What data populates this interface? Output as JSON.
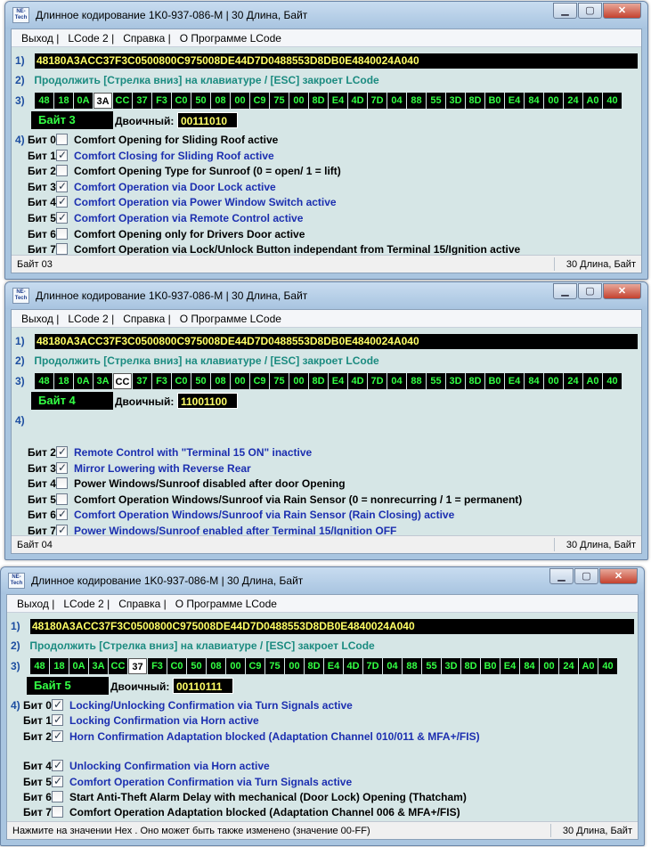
{
  "windows": [
    {
      "title": "Длинное кодирование  1K0-937-086-M | 30 Длина, Байт",
      "logo_text": "NE-Tech",
      "menu": [
        "Выход |",
        "LCode 2 |",
        "Справка |",
        "О Программе LCode"
      ],
      "step1_num": "1)",
      "hex_string": "48180A3ACC37F3C0500800C975008DE44D7D0488553D8DB0E4840024A040",
      "step2_num": "2)",
      "step2_text": "Продолжить [Стрелка вниз] на клавиатуре / [ESC] закроет LCode",
      "step3_num": "3)",
      "bytes": [
        "48",
        "18",
        "0A",
        "3A",
        "CC",
        "37",
        "F3",
        "C0",
        "50",
        "08",
        "00",
        "C9",
        "75",
        "00",
        "8D",
        "E4",
        "4D",
        "7D",
        "04",
        "88",
        "55",
        "3D",
        "8D",
        "B0",
        "E4",
        "84",
        "00",
        "24",
        "A0",
        "40"
      ],
      "selected_byte_index": 3,
      "byte_label": "Байт 3",
      "binary_label": "Двоичный:",
      "binary_value": "00111010",
      "step4_num": "4)",
      "bits": [
        {
          "label": "Бит 0",
          "checked": false,
          "text": "Comfort Opening for Sliding Roof active"
        },
        {
          "label": "Бит 1",
          "checked": true,
          "text": "Comfort Closing for Sliding Roof active"
        },
        {
          "label": "Бит 2",
          "checked": false,
          "text": "Comfort Opening Type for Sunroof (0 = open/ 1 = lift)"
        },
        {
          "label": "Бит 3",
          "checked": true,
          "text": "Comfort Operation via Door Lock active"
        },
        {
          "label": "Бит 4",
          "checked": true,
          "text": "Comfort Operation via Power Window Switch active"
        },
        {
          "label": "Бит 5",
          "checked": true,
          "text": "Comfort Operation via Remote Control active"
        },
        {
          "label": "Бит 6",
          "checked": false,
          "text": "Comfort Opening only for Drivers Door active"
        },
        {
          "label": "Бит 7",
          "checked": false,
          "text": "Comfort Operation via Lock/Unlock Button independant from Terminal 15/Ignition active"
        }
      ],
      "status_left": "Байт 03",
      "status_right": "30 Длина, Байт"
    },
    {
      "title": "Длинное кодирование  1K0-937-086-M | 30 Длина, Байт",
      "logo_text": "NE-Tech",
      "menu": [
        "Выход |",
        "LCode 2 |",
        "Справка |",
        "О Программе LCode"
      ],
      "step1_num": "1)",
      "hex_string": "48180A3ACC37F3C0500800C975008DE44D7D0488553D8DB0E4840024A040",
      "step2_num": "2)",
      "step2_text": "Продолжить [Стрелка вниз] на клавиатуре / [ESC] закроет LCode",
      "step3_num": "3)",
      "bytes": [
        "48",
        "18",
        "0A",
        "3A",
        "CC",
        "37",
        "F3",
        "C0",
        "50",
        "08",
        "00",
        "C9",
        "75",
        "00",
        "8D",
        "E4",
        "4D",
        "7D",
        "04",
        "88",
        "55",
        "3D",
        "8D",
        "B0",
        "E4",
        "84",
        "00",
        "24",
        "A0",
        "40"
      ],
      "selected_byte_index": 4,
      "byte_label": "Байт 4",
      "binary_label": "Двоичный:",
      "binary_value": "11001100",
      "step4_num": "4)",
      "bits": [
        {
          "label": "Бит 2",
          "checked": true,
          "text": "Remote Control with \"Terminal 15 ON\" inactive"
        },
        {
          "label": "Бит 3",
          "checked": true,
          "text": "Mirror Lowering with Reverse Rear"
        },
        {
          "label": "Бит 4",
          "checked": false,
          "text": "Power Windows/Sunroof disabled after door Opening"
        },
        {
          "label": "Бит 5",
          "checked": false,
          "text": "Comfort Operation Windows/Sunroof via Rain Sensor (0 = nonrecurring / 1 = permanent)"
        },
        {
          "label": "Бит 6",
          "checked": true,
          "text": "Comfort Operation Windows/Sunroof via Rain Sensor (Rain Closing) active"
        },
        {
          "label": "Бит 7",
          "checked": true,
          "text": "Power Windows/Sunroof enabled after Terminal 15/Ignition OFF"
        }
      ],
      "status_left": "Байт 04",
      "status_right": "30 Длина, Байт"
    },
    {
      "title": "Длинное кодирование  1K0-937-086-M | 30 Длина, Байт",
      "logo_text": "NE-Tech",
      "menu": [
        "Выход |",
        "LCode 2 |",
        "Справка |",
        "О Программе LCode"
      ],
      "step1_num": "1)",
      "hex_string": "48180A3ACC37F3C0500800C975008DE44D7D0488553D8DB0E4840024A040",
      "step2_num": "2)",
      "step2_text": "Продолжить [Стрелка вниз] на клавиатуре / [ESC] закроет LCode",
      "step3_num": "3)",
      "bytes": [
        "48",
        "18",
        "0A",
        "3A",
        "CC",
        "37",
        "F3",
        "C0",
        "50",
        "08",
        "00",
        "C9",
        "75",
        "00",
        "8D",
        "E4",
        "4D",
        "7D",
        "04",
        "88",
        "55",
        "3D",
        "8D",
        "B0",
        "E4",
        "84",
        "00",
        "24",
        "A0",
        "40"
      ],
      "selected_byte_index": 5,
      "byte_label": "Байт 5",
      "binary_label": "Двоичный:",
      "binary_value": "00110111",
      "step4_num": "4)",
      "bits": [
        {
          "label": "Бит 0",
          "checked": true,
          "text": "Locking/Unlocking Confirmation via Turn Signals active"
        },
        {
          "label": "Бит 1",
          "checked": true,
          "text": "Locking Confirmation via Horn active"
        },
        {
          "label": "Бит 2",
          "checked": true,
          "text": "Horn Confirmation Adaptation blocked (Adaptation Channel 010/011 & MFA+/FIS)"
        },
        {
          "label": "Бит 4",
          "checked": true,
          "text": "Unlocking Confirmation via Horn active"
        },
        {
          "label": "Бит 5",
          "checked": true,
          "text": "Comfort Operation Confirmation via Turn Signals active"
        },
        {
          "label": "Бит 6",
          "checked": false,
          "text": "Start Anti-Theft Alarm Delay with mechanical (Door Lock) Opening (Thatcham)"
        },
        {
          "label": "Бит 7",
          "checked": false,
          "text": "Comfort Operation Adaptation blocked (Adaptation Channel 006 & MFA+/FIS)"
        }
      ],
      "status_left": "Нажмите на значении Hex . Оно может быть также изменено (значение 00-FF)",
      "status_right": "30 Длина, Байт"
    }
  ]
}
